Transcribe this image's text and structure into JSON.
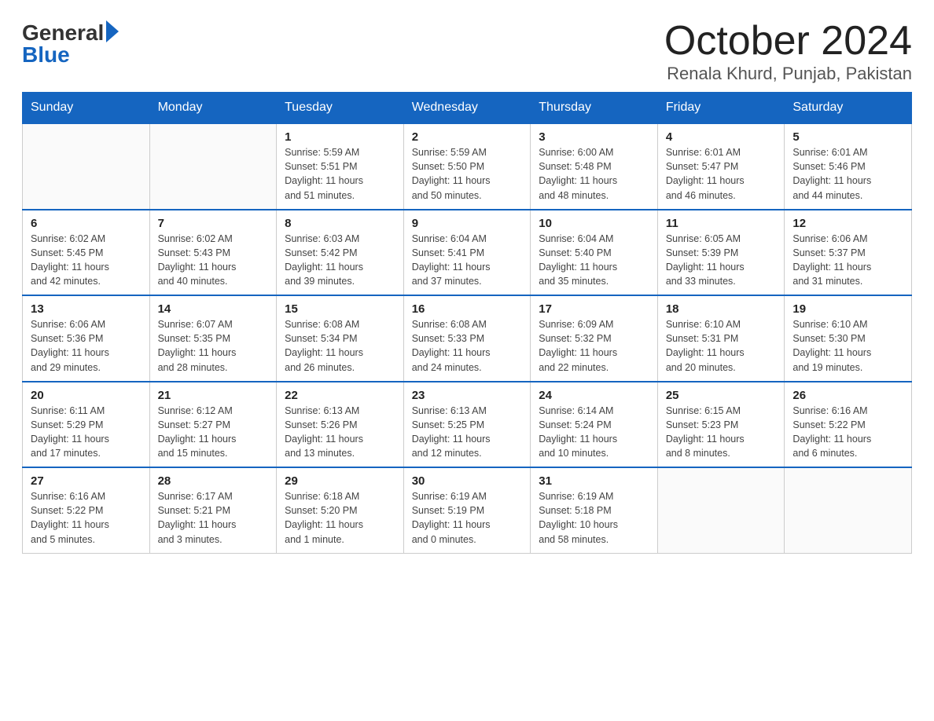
{
  "logo": {
    "general": "General",
    "blue": "Blue"
  },
  "title": {
    "month_year": "October 2024",
    "location": "Renala Khurd, Punjab, Pakistan"
  },
  "days_of_week": [
    "Sunday",
    "Monday",
    "Tuesday",
    "Wednesday",
    "Thursday",
    "Friday",
    "Saturday"
  ],
  "weeks": [
    [
      {
        "day": "",
        "info": ""
      },
      {
        "day": "",
        "info": ""
      },
      {
        "day": "1",
        "info": "Sunrise: 5:59 AM\nSunset: 5:51 PM\nDaylight: 11 hours\nand 51 minutes."
      },
      {
        "day": "2",
        "info": "Sunrise: 5:59 AM\nSunset: 5:50 PM\nDaylight: 11 hours\nand 50 minutes."
      },
      {
        "day": "3",
        "info": "Sunrise: 6:00 AM\nSunset: 5:48 PM\nDaylight: 11 hours\nand 48 minutes."
      },
      {
        "day": "4",
        "info": "Sunrise: 6:01 AM\nSunset: 5:47 PM\nDaylight: 11 hours\nand 46 minutes."
      },
      {
        "day": "5",
        "info": "Sunrise: 6:01 AM\nSunset: 5:46 PM\nDaylight: 11 hours\nand 44 minutes."
      }
    ],
    [
      {
        "day": "6",
        "info": "Sunrise: 6:02 AM\nSunset: 5:45 PM\nDaylight: 11 hours\nand 42 minutes."
      },
      {
        "day": "7",
        "info": "Sunrise: 6:02 AM\nSunset: 5:43 PM\nDaylight: 11 hours\nand 40 minutes."
      },
      {
        "day": "8",
        "info": "Sunrise: 6:03 AM\nSunset: 5:42 PM\nDaylight: 11 hours\nand 39 minutes."
      },
      {
        "day": "9",
        "info": "Sunrise: 6:04 AM\nSunset: 5:41 PM\nDaylight: 11 hours\nand 37 minutes."
      },
      {
        "day": "10",
        "info": "Sunrise: 6:04 AM\nSunset: 5:40 PM\nDaylight: 11 hours\nand 35 minutes."
      },
      {
        "day": "11",
        "info": "Sunrise: 6:05 AM\nSunset: 5:39 PM\nDaylight: 11 hours\nand 33 minutes."
      },
      {
        "day": "12",
        "info": "Sunrise: 6:06 AM\nSunset: 5:37 PM\nDaylight: 11 hours\nand 31 minutes."
      }
    ],
    [
      {
        "day": "13",
        "info": "Sunrise: 6:06 AM\nSunset: 5:36 PM\nDaylight: 11 hours\nand 29 minutes."
      },
      {
        "day": "14",
        "info": "Sunrise: 6:07 AM\nSunset: 5:35 PM\nDaylight: 11 hours\nand 28 minutes."
      },
      {
        "day": "15",
        "info": "Sunrise: 6:08 AM\nSunset: 5:34 PM\nDaylight: 11 hours\nand 26 minutes."
      },
      {
        "day": "16",
        "info": "Sunrise: 6:08 AM\nSunset: 5:33 PM\nDaylight: 11 hours\nand 24 minutes."
      },
      {
        "day": "17",
        "info": "Sunrise: 6:09 AM\nSunset: 5:32 PM\nDaylight: 11 hours\nand 22 minutes."
      },
      {
        "day": "18",
        "info": "Sunrise: 6:10 AM\nSunset: 5:31 PM\nDaylight: 11 hours\nand 20 minutes."
      },
      {
        "day": "19",
        "info": "Sunrise: 6:10 AM\nSunset: 5:30 PM\nDaylight: 11 hours\nand 19 minutes."
      }
    ],
    [
      {
        "day": "20",
        "info": "Sunrise: 6:11 AM\nSunset: 5:29 PM\nDaylight: 11 hours\nand 17 minutes."
      },
      {
        "day": "21",
        "info": "Sunrise: 6:12 AM\nSunset: 5:27 PM\nDaylight: 11 hours\nand 15 minutes."
      },
      {
        "day": "22",
        "info": "Sunrise: 6:13 AM\nSunset: 5:26 PM\nDaylight: 11 hours\nand 13 minutes."
      },
      {
        "day": "23",
        "info": "Sunrise: 6:13 AM\nSunset: 5:25 PM\nDaylight: 11 hours\nand 12 minutes."
      },
      {
        "day": "24",
        "info": "Sunrise: 6:14 AM\nSunset: 5:24 PM\nDaylight: 11 hours\nand 10 minutes."
      },
      {
        "day": "25",
        "info": "Sunrise: 6:15 AM\nSunset: 5:23 PM\nDaylight: 11 hours\nand 8 minutes."
      },
      {
        "day": "26",
        "info": "Sunrise: 6:16 AM\nSunset: 5:22 PM\nDaylight: 11 hours\nand 6 minutes."
      }
    ],
    [
      {
        "day": "27",
        "info": "Sunrise: 6:16 AM\nSunset: 5:22 PM\nDaylight: 11 hours\nand 5 minutes."
      },
      {
        "day": "28",
        "info": "Sunrise: 6:17 AM\nSunset: 5:21 PM\nDaylight: 11 hours\nand 3 minutes."
      },
      {
        "day": "29",
        "info": "Sunrise: 6:18 AM\nSunset: 5:20 PM\nDaylight: 11 hours\nand 1 minute."
      },
      {
        "day": "30",
        "info": "Sunrise: 6:19 AM\nSunset: 5:19 PM\nDaylight: 11 hours\nand 0 minutes."
      },
      {
        "day": "31",
        "info": "Sunrise: 6:19 AM\nSunset: 5:18 PM\nDaylight: 10 hours\nand 58 minutes."
      },
      {
        "day": "",
        "info": ""
      },
      {
        "day": "",
        "info": ""
      }
    ]
  ]
}
